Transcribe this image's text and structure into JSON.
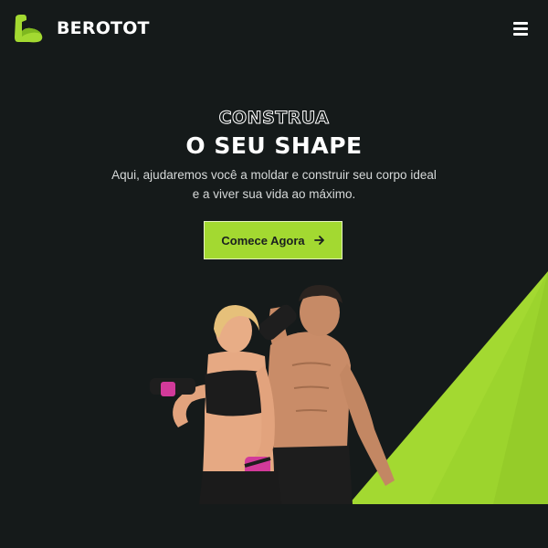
{
  "brand": {
    "name": "BEROTOT",
    "logo_icon": "flexed-arm-icon",
    "accent_color": "#a3d931",
    "background_color": "#151a1a"
  },
  "header": {
    "menu_icon": "hamburger-menu-icon"
  },
  "hero": {
    "eyebrow": "CONSTRUA",
    "title": "O SEU SHAPE",
    "subtitle": "Aqui, ajudaremos você a moldar e construir seu corpo ideal e a viver sua vida ao máximo.",
    "cta_label": "Comece Agora",
    "cta_icon": "arrow-right-icon"
  },
  "hero_image": {
    "subject": "fitness-couple-with-dumbbells"
  }
}
